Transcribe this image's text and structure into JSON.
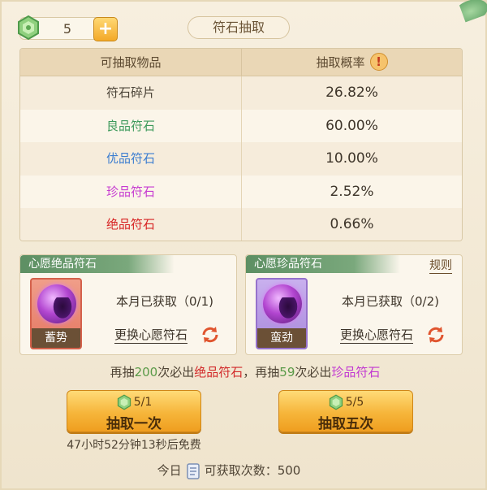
{
  "currency": {
    "count": "5",
    "add_label": "+"
  },
  "title": "符石抽取",
  "table": {
    "col_item": "可抽取物品",
    "col_rate": "抽取概率",
    "info_glyph": "!",
    "rows": [
      {
        "name": "符石碎片",
        "rate": "26.82%",
        "color": "#4b4337"
      },
      {
        "name": "良品符石",
        "rate": "60.00%",
        "color": "#3e9a5c"
      },
      {
        "name": "优品符石",
        "rate": "10.00%",
        "color": "#3b7dd0"
      },
      {
        "name": "珍品符石",
        "rate": "2.52%",
        "color": "#c63bd1"
      },
      {
        "name": "绝品符石",
        "rate": "0.66%",
        "color": "#d72424"
      }
    ]
  },
  "wish_left": {
    "header": "心愿绝品符石",
    "portrait_name": "蓄势",
    "progress": "本月已获取（0/1)",
    "change": "更换心愿符石"
  },
  "wish_right": {
    "header": "心愿珍品符石",
    "rules": "规则",
    "portrait_name": "蛮劲",
    "progress": "本月已获取（0/2)",
    "change": "更换心愿符石"
  },
  "guarantee": {
    "p1": "再抽",
    "n1": "200",
    "p2": "次必出",
    "t1": "绝品符石",
    "p3": "，再抽",
    "n2": "59",
    "p4": "次必出",
    "t2": "珍品符石"
  },
  "draw_one": {
    "cost": "5/1",
    "label": "抽取一次"
  },
  "draw_five": {
    "cost": "5/5",
    "label": "抽取五次"
  },
  "free_timer": "47小时52分钟13秒后免费",
  "daily": {
    "prefix": "今日",
    "suffix": "可获取次数：500"
  },
  "colors": {
    "accent": "#f6b53a",
    "wish_header": "#5d8f63"
  }
}
